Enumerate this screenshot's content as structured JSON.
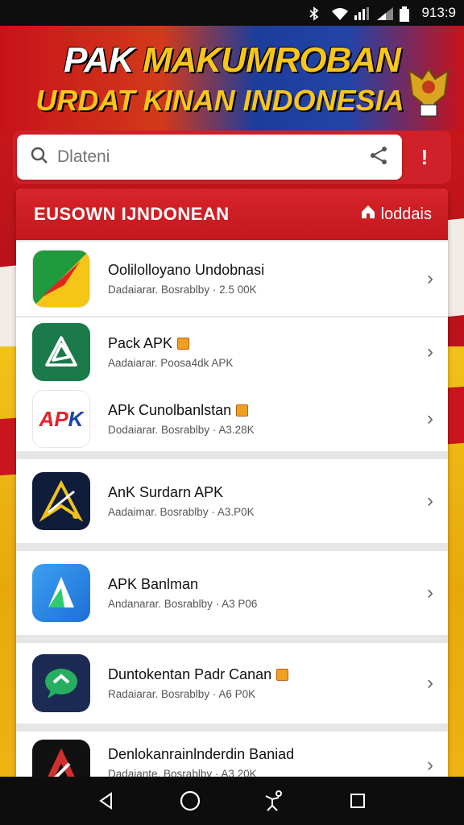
{
  "status_bar": {
    "time": "913:9",
    "icons": [
      "bluetooth-icon",
      "wifi-icon",
      "signal-icon",
      "signal-icon",
      "battery-icon"
    ]
  },
  "banner": {
    "line1_a": "PAK ",
    "line1_b": "MAKUMROBAN",
    "line2": "URDAT KINAN INDONESIA",
    "emblem_icon": "garuda-emblem-icon"
  },
  "search": {
    "placeholder": "Dlateni",
    "icon": "search-icon",
    "share_icon": "share-icon",
    "alert_label": "!"
  },
  "panel": {
    "title": "EUSOWN IJNDONEAN",
    "link_label": "loddais",
    "link_icon": "home-icon"
  },
  "apps": [
    {
      "name": "Oolilolloyano Undobnasi",
      "meta": "Dadaiarar. Bosrablby · 2.5 00K",
      "badge": false,
      "icon": "green-flag-app-icon",
      "colors": [
        "#1f9a3c",
        "#f5c518",
        "#e0261e"
      ]
    },
    {
      "name": "Pack APK",
      "meta": "Aadaiarar. Poosa4dk APK",
      "badge": true,
      "icon": "green-triangle-app-icon",
      "colors": [
        "#1a7a4a"
      ]
    },
    {
      "name": "APk Cunolbanlstan",
      "meta": "Dodaiarar. Bosrablby · A3.28K",
      "badge": true,
      "icon": "apk-text-app-icon",
      "text": "APK",
      "colors": [
        "#e3212b",
        "#1d3fa8"
      ]
    },
    {
      "name": "AnK Surdarn APK",
      "meta": "Aadaimar. Bosrablby · A3.P0K",
      "badge": false,
      "icon": "dark-blue-star-app-icon",
      "colors": [
        "#0f1c3a",
        "#f2c21a"
      ]
    },
    {
      "name": "APK Banlman",
      "meta": "Andanarar. Bosrablby · A3 P06",
      "badge": false,
      "icon": "blue-triangle-app-icon",
      "colors": [
        "#1e88e5",
        "#2ecc71"
      ]
    },
    {
      "name": "Duntokentan Padr Canan",
      "meta": "Radaiarar. Bosrablby · A6 P0K",
      "badge": true,
      "icon": "chat-bubble-app-icon",
      "colors": [
        "#1b2b54",
        "#27ae60"
      ]
    },
    {
      "name": "Denlokanrainlnderdin Baniad",
      "meta": "Dadaiante. Bosrablby · A3 20K",
      "badge": false,
      "icon": "dark-red-triangle-app-icon",
      "colors": [
        "#111",
        "#d32f2f"
      ]
    }
  ],
  "nav_bar": {
    "icons": [
      "back-icon",
      "home-circle-icon",
      "accessibility-icon",
      "recents-icon"
    ]
  }
}
